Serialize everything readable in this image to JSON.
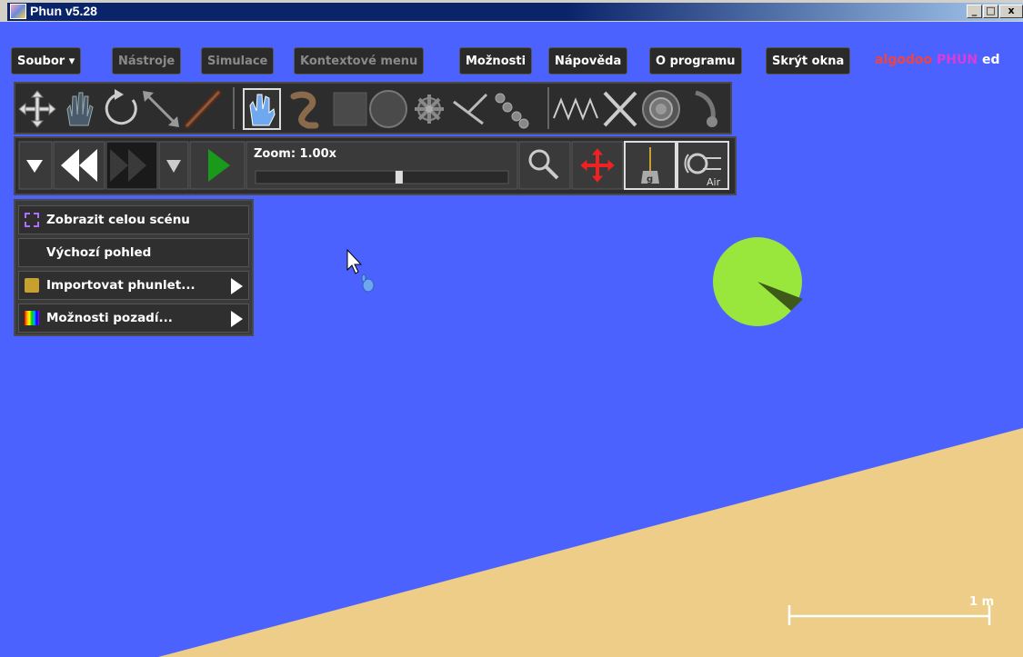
{
  "window": {
    "title": "Phun v5.28",
    "minimize_label": "_",
    "maximize_label": "□",
    "close_label": "x"
  },
  "menu": {
    "items": [
      {
        "label": "Soubor ▾",
        "enabled": true
      },
      {
        "label": "Nástroje",
        "enabled": false
      },
      {
        "label": "Simulace",
        "enabled": false
      },
      {
        "label": "Kontextové menu",
        "enabled": false
      },
      {
        "label": "Možnosti",
        "enabled": true
      },
      {
        "label": "Nápověda",
        "enabled": true
      },
      {
        "label": "O programu",
        "enabled": true
      },
      {
        "label": "Skrýt okna",
        "enabled": true
      }
    ],
    "brand": {
      "part1": "algodoo",
      "part2": "PHUN",
      "part3": "ed"
    }
  },
  "tools": {
    "items": [
      "move-tool-icon",
      "hand-tool-icon",
      "rotate-tool-icon",
      "scale-tool-icon",
      "knife-tool-icon",
      "brush-tool-icon",
      "sketch-tool-icon",
      "box-tool-icon",
      "circle-tool-icon",
      "gear-tool-icon",
      "fixate-tool-icon",
      "chain-tool-icon",
      "spring-tool-icon",
      "hinge-tool-icon",
      "thruster-tool-icon",
      "tracer-tool-icon"
    ]
  },
  "sim": {
    "zoom_label": "Zoom: 1.00x",
    "zoom_level": 0.57,
    "air_label": "Air",
    "gravity_label": "g"
  },
  "context": {
    "items": [
      {
        "label": "Zobrazit celou scénu"
      },
      {
        "label": "Výchozí pohled"
      },
      {
        "label": "Importovat phunlet..."
      },
      {
        "label": "Možnosti pozadí..."
      }
    ]
  },
  "scene": {
    "scale_label": "1 m",
    "colors": {
      "water": "#4b62ff",
      "ground": "#edcd87",
      "circle": "#99e63c",
      "circle_marker": "#3e5a19"
    }
  }
}
